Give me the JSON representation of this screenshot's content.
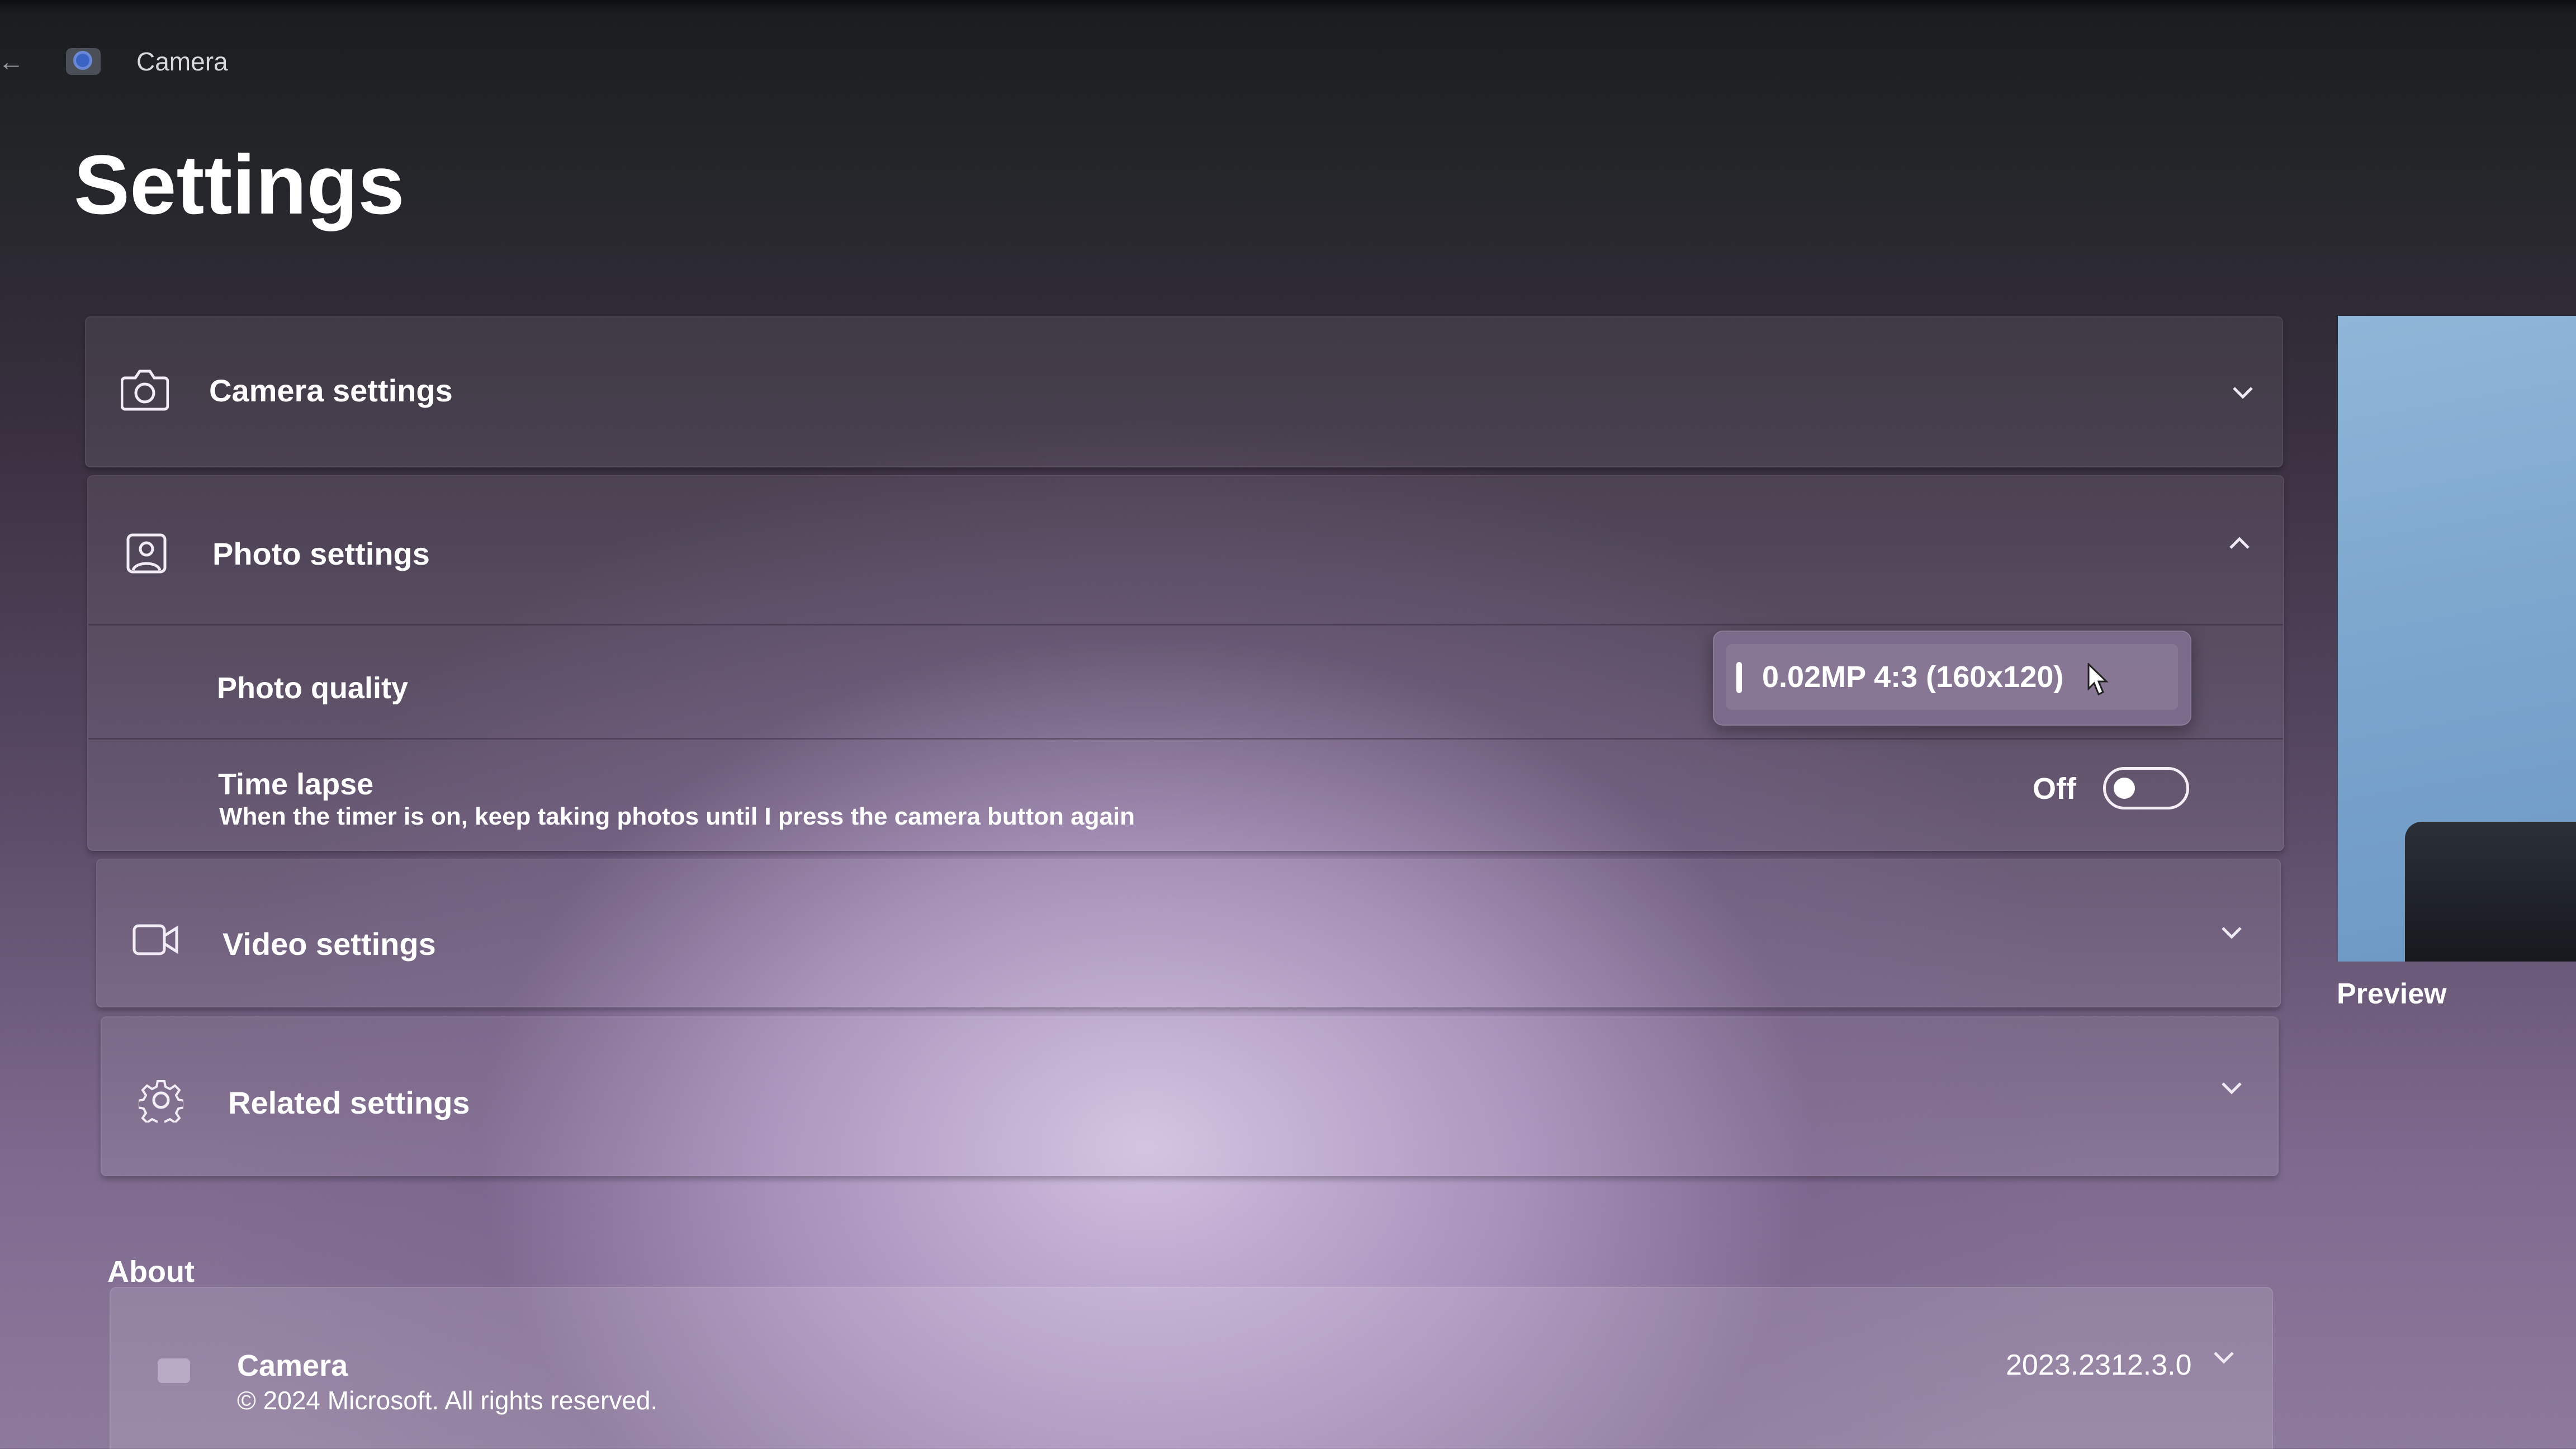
{
  "window": {
    "back_icon": "back-arrow-icon",
    "app_icon": "camera-app-icon",
    "app_name": "Camera"
  },
  "page": {
    "title": "Settings"
  },
  "sections": {
    "camera": {
      "label": "Camera settings",
      "icon": "camera-icon",
      "expanded": false
    },
    "photo": {
      "label": "Photo settings",
      "icon": "photo-icon",
      "expanded": true,
      "photo_quality": {
        "label": "Photo quality",
        "selected_option": "0.02MP 4:3 (160x120)"
      },
      "time_lapse": {
        "label": "Time lapse",
        "description": "When the timer is on, keep taking photos until I press the camera button again",
        "state_label": "Off",
        "on": false
      }
    },
    "video": {
      "label": "Video settings",
      "icon": "video-icon",
      "expanded": false
    },
    "related": {
      "label": "Related settings",
      "icon": "gear-icon",
      "expanded": false
    }
  },
  "preview": {
    "label": "Preview"
  },
  "about": {
    "title": "About",
    "app_name": "Camera",
    "copyright": "© 2024 Microsoft. All rights reserved.",
    "version": "2023.2312.3.0"
  }
}
